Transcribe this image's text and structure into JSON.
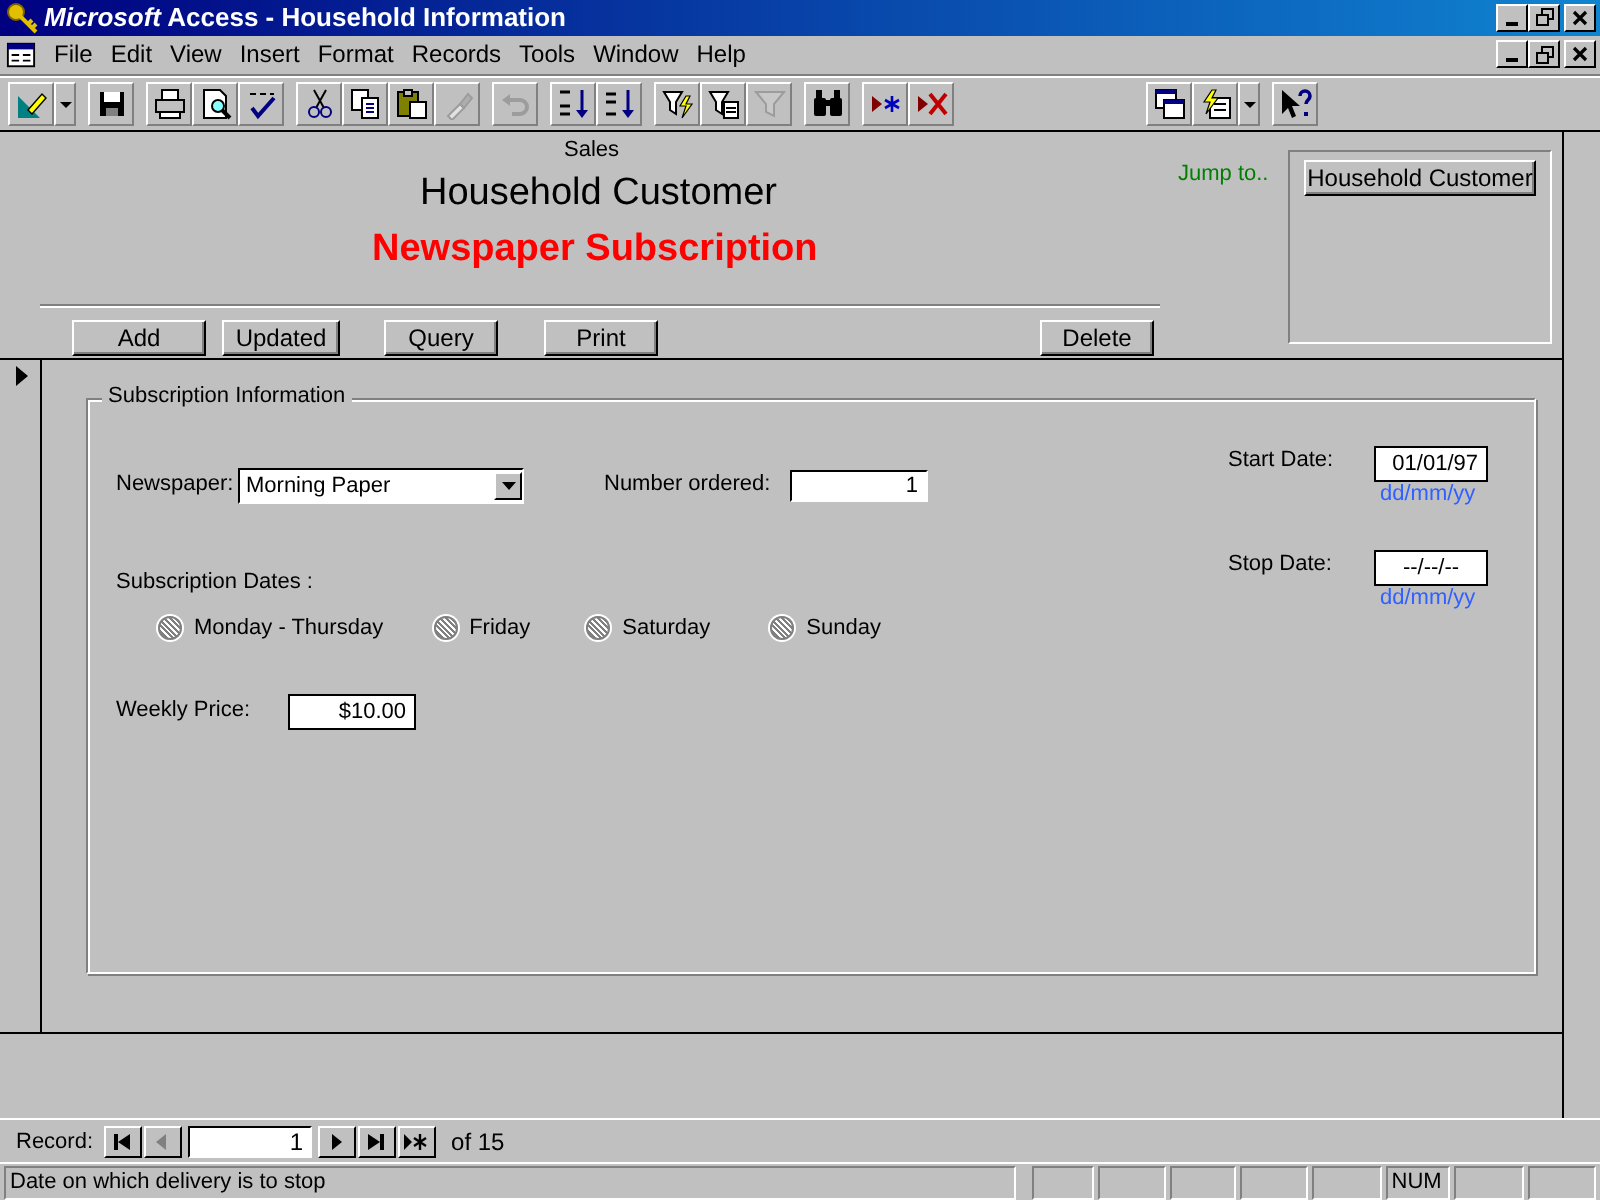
{
  "window": {
    "title": "*Microsoft* Access - Household Information"
  },
  "menu": [
    {
      "label": "File"
    },
    {
      "label": "Edit"
    },
    {
      "label": "View"
    },
    {
      "label": "Insert"
    },
    {
      "label": "Format"
    },
    {
      "label": "Records"
    },
    {
      "label": "Tools"
    },
    {
      "label": "Window"
    },
    {
      "label": "Help"
    }
  ],
  "toolbar_left": [
    [
      {
        "kind": "design",
        "disabled": false
      },
      {
        "kind": "dropdown",
        "disabled": false
      }
    ],
    [
      {
        "kind": "save",
        "disabled": false
      }
    ],
    [
      {
        "kind": "print",
        "disabled": false
      },
      {
        "kind": "preview",
        "disabled": false
      },
      {
        "kind": "spelling",
        "disabled": false
      }
    ],
    [
      {
        "kind": "cut",
        "disabled": false
      },
      {
        "kind": "copy",
        "disabled": false
      },
      {
        "kind": "paste",
        "disabled": false
      },
      {
        "kind": "painter",
        "disabled": true
      }
    ],
    [
      {
        "kind": "undo",
        "disabled": true
      }
    ],
    [
      {
        "kind": "sort_asc",
        "disabled": false
      },
      {
        "kind": "sort_desc",
        "disabled": false
      }
    ],
    [
      {
        "kind": "filter_selection",
        "disabled": false
      },
      {
        "kind": "filter_form",
        "disabled": false
      },
      {
        "kind": "apply_filter",
        "disabled": true
      }
    ],
    [
      {
        "kind": "find",
        "disabled": false
      }
    ],
    [
      {
        "kind": "new_record",
        "disabled": false
      },
      {
        "kind": "delete_record",
        "disabled": false
      }
    ]
  ],
  "toolbar_right": [
    [
      {
        "kind": "database_window",
        "disabled": false
      },
      {
        "kind": "new_object",
        "disabled": false
      },
      {
        "kind": "dropdown",
        "disabled": false
      }
    ],
    [
      {
        "kind": "help",
        "disabled": false
      }
    ]
  ],
  "form_header": {
    "caption": "Sales",
    "title": "Household Customer",
    "subtitle": "Newspaper Subscription",
    "jump_label": "Jump to..",
    "jump_button": "Household Customer",
    "buttons": [
      {
        "label": "Add"
      },
      {
        "label": "Updated"
      },
      {
        "label": "Query"
      },
      {
        "label": "Print"
      },
      {
        "label": "Delete"
      }
    ]
  },
  "detail": {
    "group_title": "Subscription Information",
    "newspaper": {
      "label": "Newspaper:",
      "value": "Morning Paper"
    },
    "number_ordered": {
      "label": "Number ordered:",
      "value": "1"
    },
    "start_date": {
      "label": "Start Date:",
      "value": "01/01/97",
      "hint": "dd/mm/yy"
    },
    "stop_date": {
      "label": "Stop Date:",
      "value": "--/--/--",
      "hint": "dd/mm/yy"
    },
    "dates_label": "Subscription Dates :",
    "days": [
      {
        "label": "Monday - Thursday",
        "selected": false
      },
      {
        "label": "Friday",
        "selected": false
      },
      {
        "label": "Saturday",
        "selected": false
      },
      {
        "label": "Sunday",
        "selected": false
      }
    ],
    "weekly_price": {
      "label": "Weekly Price:",
      "value": "$10.00"
    }
  },
  "record_nav": {
    "label": "Record:",
    "current": "1",
    "of_label": "of",
    "total": "15"
  },
  "status_bar": {
    "message": "Date on which delivery is to stop",
    "num_indicator": "NUM"
  }
}
